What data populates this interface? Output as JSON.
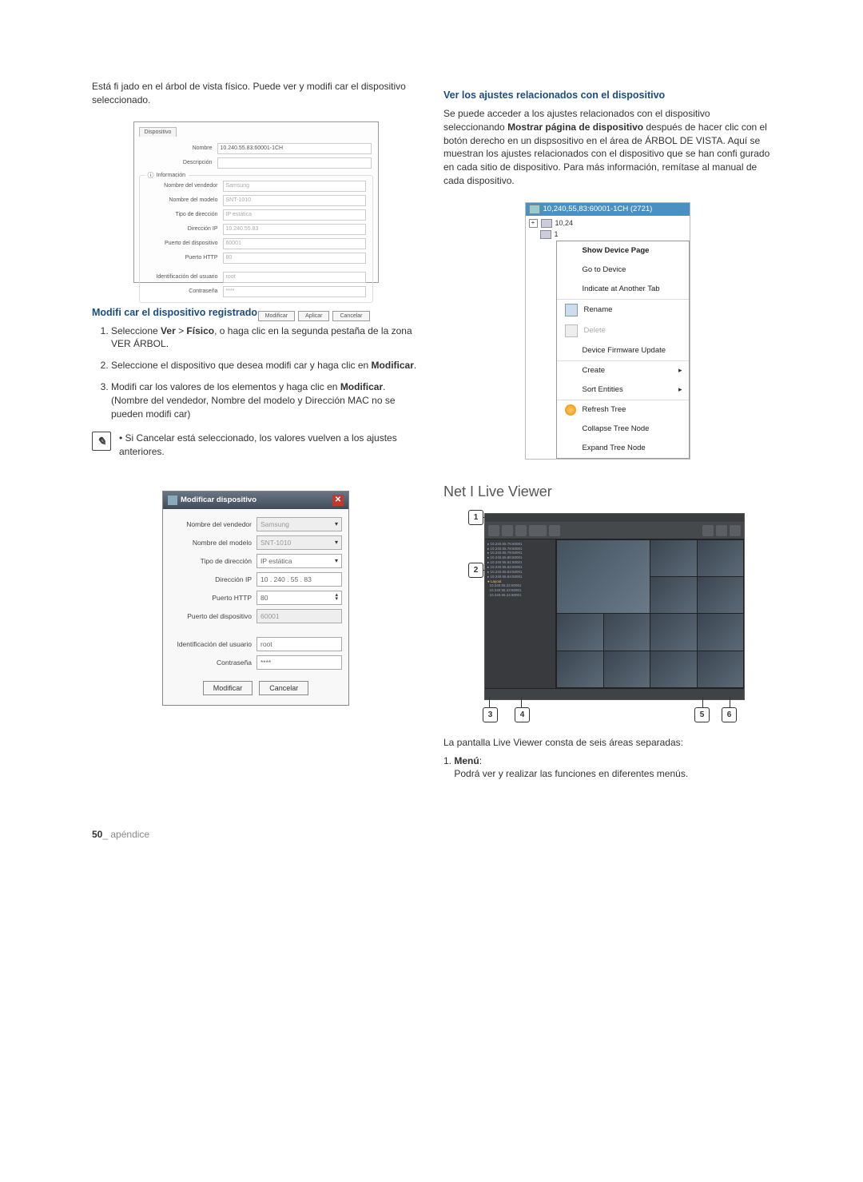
{
  "intro": "Está fi jado en el árbol de vista físico. Puede ver y modifi car el dispositivo seleccionado.",
  "panel1": {
    "tab": "Dispositivo",
    "name_label": "Nombre",
    "name_value": "10.240.55.83:60001-1CH",
    "desc_label": "Descripción",
    "section": "Información",
    "rows": {
      "vendor_label": "Nombre del vendedor",
      "vendor_value": "Samsung",
      "model_label": "Nombre del modelo",
      "model_value": "SNT-1010",
      "addrtype_label": "Tipo de dirección",
      "addrtype_value": "IP estática",
      "ip_label": "Dirección IP",
      "ip_value": "10.240.55.83",
      "devport_label": "Puerto del dispositivo",
      "devport_value": "60001",
      "http_label": "Puerto HTTP",
      "http_value": "80",
      "user_label": "Identificación del usuario",
      "user_value": "root",
      "pass_label": "Contraseña",
      "pass_value": "****"
    },
    "btn_mod": "Modificar",
    "btn_apply": "Aplicar",
    "btn_cancel": "Cancelar"
  },
  "mod_heading": "Modifi car el dispositivo registrado",
  "mod_steps": {
    "s1a": "Seleccione ",
    "s1b": "Ver",
    "s1c": " > ",
    "s1d": "Físico",
    "s1e": ", o haga clic en la segunda pestaña de la zona VER ÁRBOL.",
    "s2a": "Seleccione el dispositivo que desea modifi car y haga clic en ",
    "s2b": "Modificar",
    "s2c": ".",
    "s3a": "Modifi car los valores de los elementos y haga clic en ",
    "s3b": "Modificar",
    "s3c": ". (Nombre del vendedor, Nombre del modelo y Dirección MAC no se pueden modifi car)"
  },
  "note": "Si Cancelar está seleccionado, los valores vuelven a los ajustes anteriores.",
  "dialog": {
    "title": "Modificar dispositivo",
    "vendor_label": "Nombre del vendedor",
    "vendor_value": "Samsung",
    "model_label": "Nombre del modelo",
    "model_value": "SNT-1010",
    "addrtype_label": "Tipo de dirección",
    "addrtype_value": "IP estática",
    "ip_label": "Dirección IP",
    "ip_value": "10  .  240  .  55  .  83",
    "http_label": "Puerto HTTP",
    "http_value": "80",
    "devport_label": "Puerto del dispositivo",
    "devport_value": "60001",
    "user_label": "Identificación del usuario",
    "user_value": "root",
    "pass_label": "Contraseña",
    "pass_value": "****",
    "btn_mod": "Modificar",
    "btn_cancel": "Cancelar"
  },
  "right": {
    "heading": "Ver los ajustes relacionados con el dispositivo",
    "p1a": "Se puede acceder a los ajustes relacionados con el dispositivo seleccionando ",
    "p1b": "Mostrar página de dispositivo",
    "p1c": " después de hacer clic con el botón derecho en un dispsositivo en el área de ÁRBOL DE VISTA. Aquí se muestran los ajustes relacionados con el dispositivo que se han confi gurado en cada sitio de dispositivo. Para más información, remítase al manual de cada dispositivo.",
    "tree_title": "10,240,55,83:60001-1CH (2721)",
    "tree_node1": "10,24",
    "tree_node2": "1",
    "menu": {
      "show": "Show Device Page",
      "goto": "Go to Device",
      "indicate": "Indicate at Another Tab",
      "rename": "Rename",
      "delete": "Delete",
      "fw": "Device Firmware Update",
      "create": "Create",
      "sort": "Sort Entities",
      "refresh": "Refresh Tree",
      "collapse": "Collapse Tree Node",
      "expand": "Expand Tree Node"
    },
    "section_title": "Net I Live Viewer",
    "caption": "La pantalla Live Viewer consta de seis áreas separadas:",
    "item1_label": "Menú",
    "item1_text": "Podrá ver y realizar las funciones en diferentes menús."
  },
  "footer": {
    "page": "50",
    "section": "_ apéndice"
  }
}
